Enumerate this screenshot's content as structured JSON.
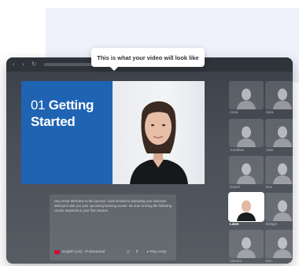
{
  "tooltip": {
    "text": "This is what your video will look like"
  },
  "slide": {
    "number": "01",
    "title_line1": "Getting",
    "title_line2": "Started"
  },
  "script": {
    "text": "Hey Anna! Welcome to the journey! I look forward to activating your welcome attempt to ask you your upcoming learning course. Be sure to bring the following course materials to your first session.",
    "language": "English (US) - Professional",
    "play_label": "Play script"
  },
  "avatars": [
    {
      "name": "Anna"
    },
    {
      "name": "Sara"
    },
    {
      "name": "Jonathan"
    },
    {
      "name": "Jake"
    },
    {
      "name": "Daniel"
    },
    {
      "name": "Eva"
    },
    {
      "name": "Lawn"
    },
    {
      "name": "Bridget"
    },
    {
      "name": "Vincent"
    },
    {
      "name": "Kim"
    }
  ],
  "active_avatar": "Lawn",
  "colors": {
    "slide_blue": "#1f63b3",
    "window": "#3a3f48",
    "page_bg": "#eef0fb"
  }
}
